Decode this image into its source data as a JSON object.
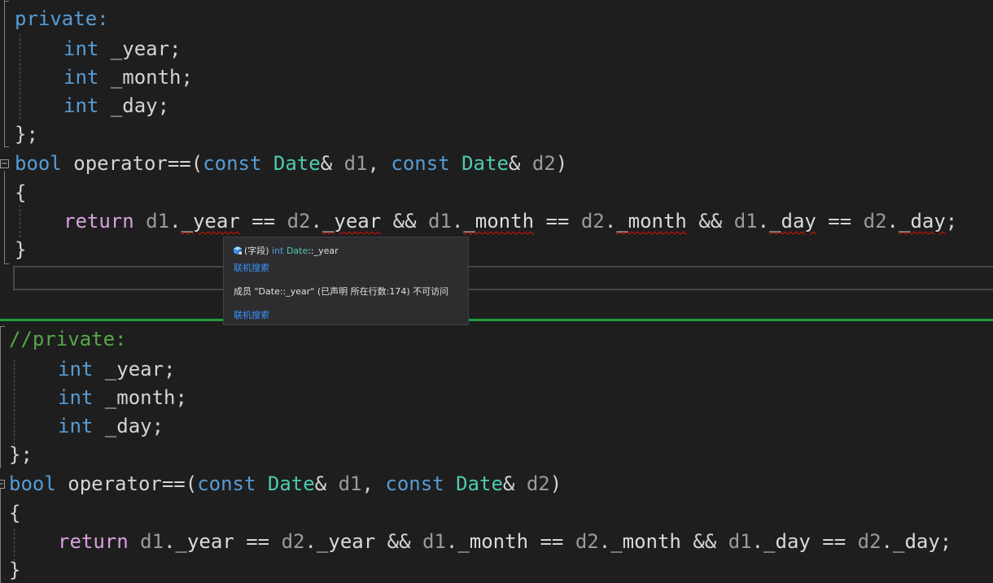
{
  "editor": {
    "top": {
      "lines": [
        {
          "tokens": [
            {
              "cls": "kw",
              "t": "private:"
            }
          ]
        },
        {
          "tokens": [
            {
              "cls": "kw",
              "t": "int"
            },
            {
              "cls": "",
              "t": " _year;"
            }
          ]
        },
        {
          "tokens": [
            {
              "cls": "kw",
              "t": "int"
            },
            {
              "cls": "",
              "t": " _month;"
            }
          ]
        },
        {
          "tokens": [
            {
              "cls": "kw",
              "t": "int"
            },
            {
              "cls": "",
              "t": " _day;"
            }
          ]
        },
        {
          "tokens": [
            {
              "cls": "",
              "t": "};"
            }
          ]
        },
        {
          "tokens": [
            {
              "cls": "kw",
              "t": "bool"
            },
            {
              "cls": "",
              "t": " operator==("
            },
            {
              "cls": "kw",
              "t": "const"
            },
            {
              "cls": "",
              "t": " "
            },
            {
              "cls": "ty",
              "t": "Date"
            },
            {
              "cls": "",
              "t": "& "
            },
            {
              "cls": "pa",
              "t": "d1"
            },
            {
              "cls": "",
              "t": ", "
            },
            {
              "cls": "kw",
              "t": "const"
            },
            {
              "cls": "",
              "t": " "
            },
            {
              "cls": "ty",
              "t": "Date"
            },
            {
              "cls": "",
              "t": "& "
            },
            {
              "cls": "pa",
              "t": "d2"
            },
            {
              "cls": "",
              "t": ")"
            }
          ]
        },
        {
          "tokens": [
            {
              "cls": "",
              "t": "{"
            }
          ]
        },
        {
          "tokens": [
            {
              "cls": "kw2",
              "t": "return"
            },
            {
              "cls": "",
              "t": " "
            },
            {
              "cls": "pa",
              "t": "d1"
            },
            {
              "cls": "",
              "t": "."
            },
            {
              "cls": "mem err",
              "t": "_year"
            },
            {
              "cls": "",
              "t": " == "
            },
            {
              "cls": "pa",
              "t": "d2"
            },
            {
              "cls": "",
              "t": "."
            },
            {
              "cls": "mem err",
              "t": "_year"
            },
            {
              "cls": "",
              "t": " && "
            },
            {
              "cls": "pa",
              "t": "d1"
            },
            {
              "cls": "",
              "t": "."
            },
            {
              "cls": "mem err",
              "t": "_month"
            },
            {
              "cls": "",
              "t": " == "
            },
            {
              "cls": "pa",
              "t": "d2"
            },
            {
              "cls": "",
              "t": "."
            },
            {
              "cls": "mem err",
              "t": "_month"
            },
            {
              "cls": "",
              "t": " && "
            },
            {
              "cls": "pa",
              "t": "d1"
            },
            {
              "cls": "",
              "t": "."
            },
            {
              "cls": "mem err",
              "t": "_day"
            },
            {
              "cls": "",
              "t": " == "
            },
            {
              "cls": "pa",
              "t": "d2"
            },
            {
              "cls": "",
              "t": "."
            },
            {
              "cls": "mem err",
              "t": "_day"
            },
            {
              "cls": "",
              "t": ";"
            }
          ]
        },
        {
          "tokens": [
            {
              "cls": "",
              "t": "}"
            }
          ]
        }
      ]
    },
    "bottom": {
      "lines": [
        {
          "tokens": [
            {
              "cls": "cm",
              "t": "//private:"
            }
          ]
        },
        {
          "tokens": [
            {
              "cls": "kw",
              "t": "int"
            },
            {
              "cls": "",
              "t": " _year;"
            }
          ]
        },
        {
          "tokens": [
            {
              "cls": "kw",
              "t": "int"
            },
            {
              "cls": "",
              "t": " _month;"
            }
          ]
        },
        {
          "tokens": [
            {
              "cls": "kw",
              "t": "int"
            },
            {
              "cls": "",
              "t": " _day;"
            }
          ]
        },
        {
          "tokens": [
            {
              "cls": "",
              "t": "};"
            }
          ]
        },
        {
          "tokens": [
            {
              "cls": "kw",
              "t": "bool"
            },
            {
              "cls": "",
              "t": " operator==("
            },
            {
              "cls": "kw",
              "t": "const"
            },
            {
              "cls": "",
              "t": " "
            },
            {
              "cls": "ty",
              "t": "Date"
            },
            {
              "cls": "",
              "t": "& "
            },
            {
              "cls": "pa",
              "t": "d1"
            },
            {
              "cls": "",
              "t": ", "
            },
            {
              "cls": "kw",
              "t": "const"
            },
            {
              "cls": "",
              "t": " "
            },
            {
              "cls": "ty",
              "t": "Date"
            },
            {
              "cls": "",
              "t": "& "
            },
            {
              "cls": "pa",
              "t": "d2"
            },
            {
              "cls": "",
              "t": ")"
            }
          ]
        },
        {
          "tokens": [
            {
              "cls": "",
              "t": "{"
            }
          ]
        },
        {
          "tokens": [
            {
              "cls": "kw2",
              "t": "return"
            },
            {
              "cls": "",
              "t": " "
            },
            {
              "cls": "pa",
              "t": "d1"
            },
            {
              "cls": "",
              "t": "."
            },
            {
              "cls": "mem",
              "t": "_year"
            },
            {
              "cls": "",
              "t": " == "
            },
            {
              "cls": "pa",
              "t": "d2"
            },
            {
              "cls": "",
              "t": "."
            },
            {
              "cls": "mem",
              "t": "_year"
            },
            {
              "cls": "",
              "t": " && "
            },
            {
              "cls": "pa",
              "t": "d1"
            },
            {
              "cls": "",
              "t": "."
            },
            {
              "cls": "mem",
              "t": "_month"
            },
            {
              "cls": "",
              "t": " == "
            },
            {
              "cls": "pa",
              "t": "d2"
            },
            {
              "cls": "",
              "t": "."
            },
            {
              "cls": "mem",
              "t": "_month"
            },
            {
              "cls": "",
              "t": " && "
            },
            {
              "cls": "pa",
              "t": "d1"
            },
            {
              "cls": "",
              "t": "."
            },
            {
              "cls": "mem",
              "t": "_day"
            },
            {
              "cls": "",
              "t": " == "
            },
            {
              "cls": "pa",
              "t": "d2"
            },
            {
              "cls": "",
              "t": "."
            },
            {
              "cls": "mem",
              "t": "_day"
            },
            {
              "cls": "",
              "t": ";"
            }
          ]
        },
        {
          "tokens": [
            {
              "cls": "",
              "t": "}"
            }
          ]
        }
      ]
    }
  },
  "tooltip": {
    "kind_label": "(字段)",
    "type_keyword": "int",
    "class_name": "Date",
    "member_sep": "::",
    "member_name": "_year",
    "search_link_1": "联机搜索",
    "error_message": "成员 \"Date::_year\" (已声明 所在行数:174) 不可访问",
    "search_link_2": "联机搜索",
    "icon": "field-cube-icon"
  },
  "fold_glyph": "−",
  "colors": {
    "background": "#1e1e1e",
    "keyword": "#569cd6",
    "control_keyword": "#d8a0df",
    "type": "#4ec9b0",
    "comment": "#57a64a",
    "error_squiggle": "#e51400",
    "split_divider": "#1f9e3e",
    "link": "#3794ff"
  }
}
